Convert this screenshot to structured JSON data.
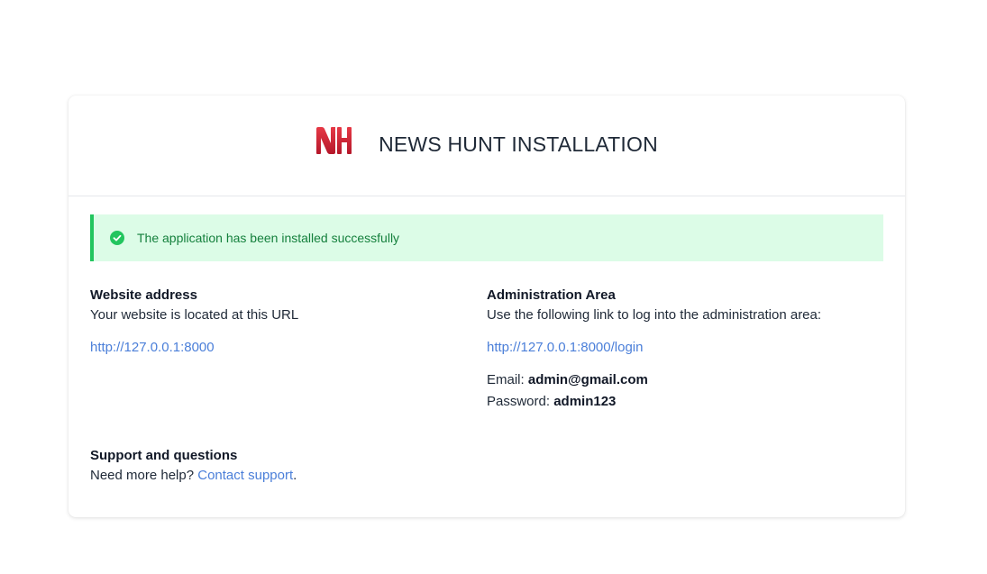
{
  "header": {
    "title": "NEWS HUNT INSTALLATION",
    "logo_text": "NH"
  },
  "alert": {
    "message": "The application has been installed successfully",
    "icon": "check-circle-icon"
  },
  "website": {
    "title": "Website address",
    "description": "Your website is located at this URL",
    "url": "http://127.0.0.1:8000"
  },
  "admin": {
    "title": "Administration Area",
    "description": "Use the following link to log into the administration area:",
    "url": "http://127.0.0.1:8000/login",
    "email_label": "Email:",
    "email_value": "admin@gmail.com",
    "password_label": "Password:",
    "password_value": "admin123"
  },
  "support": {
    "title": "Support and questions",
    "text_before": "Need more help?",
    "link_text": "Contact support",
    "text_after": "."
  },
  "colors": {
    "success_bg": "#dcfce7",
    "success_border": "#22c55e",
    "success_text": "#15803d",
    "link": "#4b7fd9",
    "logo_red": "#d62828"
  }
}
